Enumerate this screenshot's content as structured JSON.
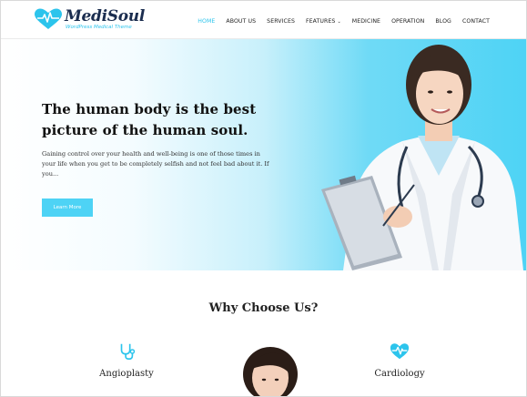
{
  "brand": {
    "name": "MediSoul",
    "tagline": "WordPress Medical Theme",
    "accent": "#2cc4ec",
    "dark": "#1b2d4f"
  },
  "nav": {
    "items": [
      {
        "label": "HOME",
        "active": true
      },
      {
        "label": "ABOUT US"
      },
      {
        "label": "SERVICES"
      },
      {
        "label": "FEATURES",
        "has_dropdown": true
      },
      {
        "label": "MEDICINE"
      },
      {
        "label": "OPERATION"
      },
      {
        "label": "BLOG"
      },
      {
        "label": "CONTACT"
      }
    ]
  },
  "hero": {
    "title": "The human body is the best picture of the human soul.",
    "text": "Gaining control over your health and well-being is one of those times in your life when you get to be completely selfish and not feel bad about it. If you...",
    "button_label": "Learn More"
  },
  "why": {
    "title": "Why Choose Us?",
    "features": [
      {
        "label": "Angioplasty",
        "icon": "stethoscope-icon"
      },
      {
        "label": "Cardiology",
        "icon": "heart-pulse-icon"
      }
    ]
  }
}
